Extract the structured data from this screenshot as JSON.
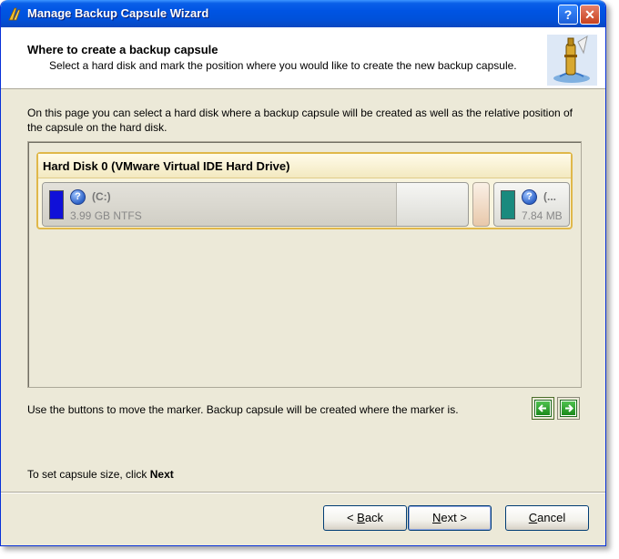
{
  "window": {
    "title": "Manage Backup Capsule Wizard"
  },
  "header": {
    "title": "Where to create a backup capsule",
    "subtitle": "Select a hard disk and mark the position where you would like to create the new backup capsule."
  },
  "description": "On this page you can select a hard disk where a backup capsule will be created as well as the relative position of the capsule on the hard disk.",
  "disk": {
    "label": "Hard Disk 0 (VMware Virtual IDE Hard Drive)",
    "partitions": [
      {
        "name": "(C:)",
        "size": "3.99 GB NTFS",
        "color": "#1010d8",
        "icon": "help-icon"
      },
      {
        "name": "(...",
        "size": "7.84 MB",
        "color": "#1a8a7e",
        "icon": "help-icon"
      }
    ]
  },
  "move_text": "Use the buttons to move the marker. Backup capsule will be created where the marker is.",
  "capsule_text_prefix": "To set capsule size, click",
  "capsule_text_bold": "Next",
  "buttons": {
    "back": {
      "pre": "< ",
      "accel": "B",
      "post": "ack"
    },
    "next": {
      "pre": "",
      "accel": "N",
      "post": "ext >"
    },
    "cancel": {
      "pre": "",
      "accel": "C",
      "post": "ancel"
    }
  },
  "colors": {
    "titlebar": "#0054e3",
    "disk_border": "#e0b84a",
    "arrow_green": "#1b8a1b"
  }
}
